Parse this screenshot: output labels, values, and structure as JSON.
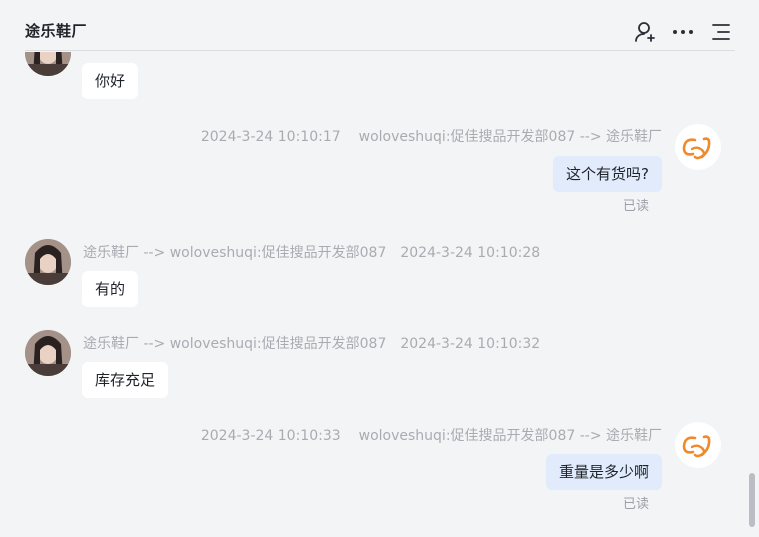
{
  "header": {
    "title": "途乐鞋厂",
    "icons": [
      "user-add-icon",
      "more-icon",
      "menu-list-icon"
    ]
  },
  "messages": [
    {
      "direction": "in",
      "text": "你好",
      "partial_top": true
    },
    {
      "direction": "out",
      "time": "2024-3-24 10:10:17",
      "route": "woloveshuqi:促佳搜品开发部087 --> 途乐鞋厂",
      "text": "这个有货吗?",
      "status": "已读"
    },
    {
      "direction": "in",
      "route": "途乐鞋厂 --> woloveshuqi:促佳搜品开发部087",
      "time": "2024-3-24 10:10:28",
      "text": "有的"
    },
    {
      "direction": "in",
      "route": "途乐鞋厂 --> woloveshuqi:促佳搜品开发部087",
      "time": "2024-3-24 10:10:32",
      "text": "库存充足"
    },
    {
      "direction": "out",
      "time": "2024-3-24 10:10:33",
      "route": "woloveshuqi:促佳搜品开发部087 --> 途乐鞋厂",
      "text": "重量是多少啊",
      "status": "已读"
    }
  ],
  "colors": {
    "background": "#f3f4f6",
    "bubble_in": "#ffffff",
    "bubble_out": "#e1ebfb",
    "meta_text": "#a8acb2",
    "logo_orange": "#f0892a"
  }
}
